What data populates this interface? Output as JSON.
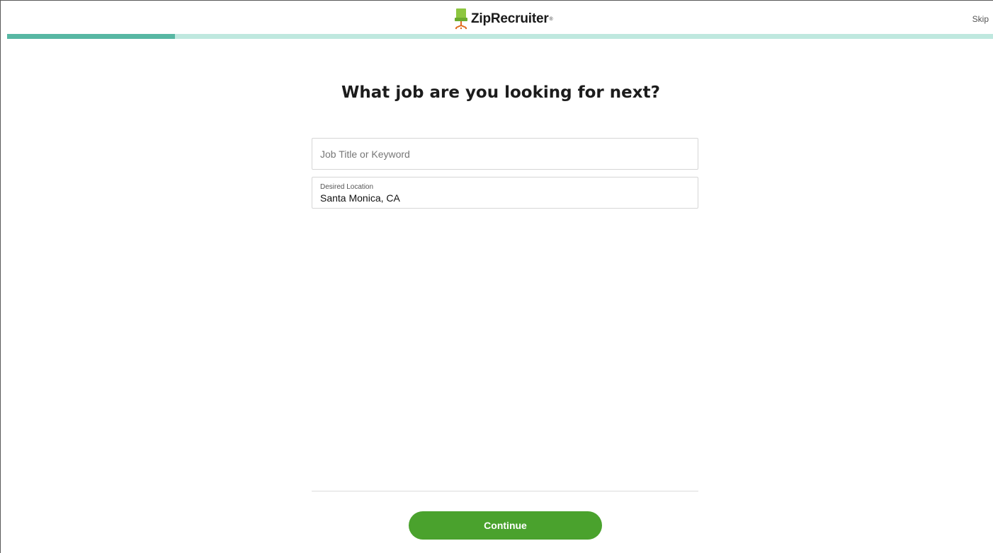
{
  "header": {
    "logo_text": "ZipRecruiter",
    "logo_mark": "®",
    "logo_icon": "office-chair-icon",
    "skip_label": "Skip"
  },
  "progress": {
    "fraction": 0.17,
    "fill_color": "#57b7a3",
    "track_color": "#bfe8df"
  },
  "main": {
    "title": "What job are you looking for next?",
    "job_field": {
      "placeholder": "Job Title or Keyword",
      "value": ""
    },
    "location_field": {
      "label": "Desired Location",
      "value": "Santa Monica, CA"
    }
  },
  "footer": {
    "continue_label": "Continue",
    "button_color": "#4aa22d"
  }
}
